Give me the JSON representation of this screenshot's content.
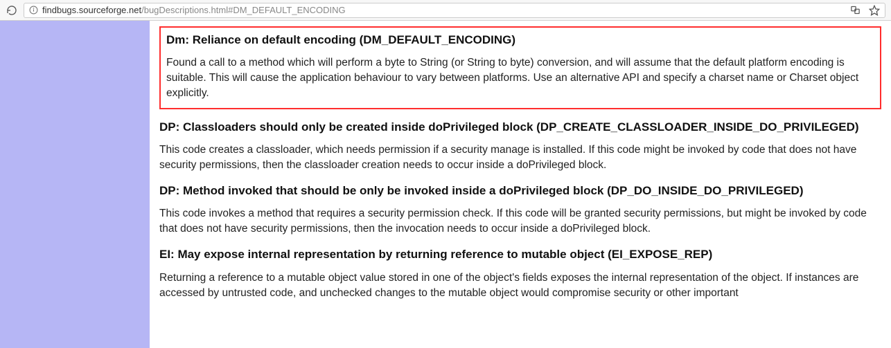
{
  "browser": {
    "url_host": "findbugs.sourceforge.net",
    "url_path": "/bugDescriptions.html#DM_DEFAULT_ENCODING"
  },
  "sections": [
    {
      "title": "Dm: Reliance on default encoding (DM_DEFAULT_ENCODING)",
      "body": "Found a call to a method which will perform a byte to String (or String to byte) conversion, and will assume that the default platform encoding is suitable. This will cause the application behaviour to vary between platforms. Use an alternative API and specify a charset name or Charset object explicitly.",
      "highlighted": true
    },
    {
      "title": "DP: Classloaders should only be created inside doPrivileged block (DP_CREATE_CLASSLOADER_INSIDE_DO_PRIVILEGED)",
      "body": "This code creates a classloader, which needs permission if a security manage is installed. If this code might be invoked by code that does not have security permissions, then the classloader creation needs to occur inside a doPrivileged block."
    },
    {
      "title": "DP: Method invoked that should be only be invoked inside a doPrivileged block (DP_DO_INSIDE_DO_PRIVILEGED)",
      "body": "This code invokes a method that requires a security permission check. If this code will be granted security permissions, but might be invoked by code that does not have security permissions, then the invocation needs to occur inside a doPrivileged block."
    },
    {
      "title": "EI: May expose internal representation by returning reference to mutable object (EI_EXPOSE_REP)",
      "body": "Returning a reference to a mutable object value stored in one of the object's fields exposes the internal representation of the object.  If instances are accessed by untrusted code, and unchecked changes to the mutable object would compromise security or other important"
    }
  ]
}
